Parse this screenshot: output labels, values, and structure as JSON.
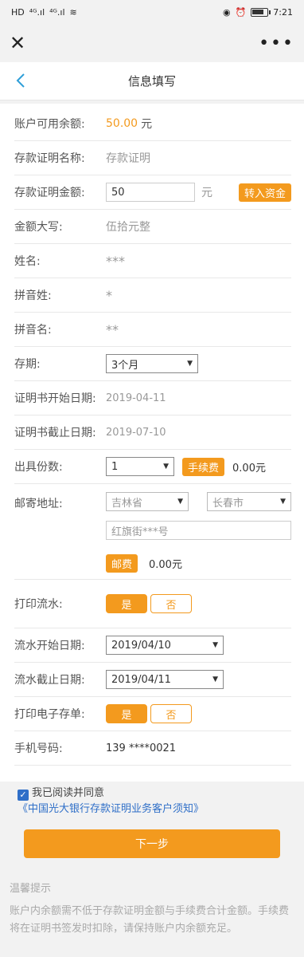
{
  "status_bar": {
    "left": [
      "HD",
      "⁴ᴳ.ıl",
      "⁴ᴳ.ıl",
      "≋"
    ],
    "time": "7:21"
  },
  "app_bar": {
    "close_icon": "close-icon",
    "more_icon": "more-icon"
  },
  "nav": {
    "title": "信息填写"
  },
  "form": {
    "balance": {
      "label": "账户可用余额:",
      "value": "50.00",
      "unit": "元"
    },
    "cert_name": {
      "label": "存款证明名称:",
      "value": "存款证明"
    },
    "cert_amount": {
      "label": "存款证明金额:",
      "value": "50",
      "unit": "元",
      "button": "转入资金"
    },
    "amount_caps": {
      "label": "金额大写:",
      "value": "伍拾元整"
    },
    "name": {
      "label": "姓名:",
      "value": "***"
    },
    "pinyin_last": {
      "label": "拼音姓:",
      "value": "*"
    },
    "pinyin_first": {
      "label": "拼音名:",
      "value": "**"
    },
    "term": {
      "label": "存期:",
      "value": "3个月"
    },
    "start_date": {
      "label": "证明书开始日期:",
      "value": "2019-04-11"
    },
    "end_date": {
      "label": "证明书截止日期:",
      "value": "2019-07-10"
    },
    "copies": {
      "label": "出具份数:",
      "value": "1",
      "fee_label": "手续费",
      "fee_value": "0.00元"
    },
    "address": {
      "label": "邮寄地址:",
      "province": "吉林省",
      "city": "长春市",
      "street": "红旗街***号",
      "postage_label": "邮费",
      "postage_value": "0.00元"
    },
    "print_flow": {
      "label": "打印流水:",
      "yes": "是",
      "no": "否"
    },
    "flow_start": {
      "label": "流水开始日期:",
      "value": "2019/04/10"
    },
    "flow_end": {
      "label": "流水截止日期:",
      "value": "2019/04/11"
    },
    "print_e_receipt": {
      "label": "打印电子存单:",
      "yes": "是",
      "no": "否"
    },
    "phone": {
      "label": "手机号码:",
      "value": "139 ****0021"
    }
  },
  "agreement": {
    "check": "✓",
    "text": "我已阅读并同意",
    "link": "《中国光大银行存款证明业务客户须知》"
  },
  "next_button": "下一步",
  "tips": {
    "title": "温馨提示",
    "body": "账户内余额需不低于存款证明金额与手续费合计金额。手续费将在证明书签发时扣除，请保持账户内余额充足。"
  },
  "colors": {
    "accent": "#f39a1e",
    "link": "#2f6fc8"
  }
}
